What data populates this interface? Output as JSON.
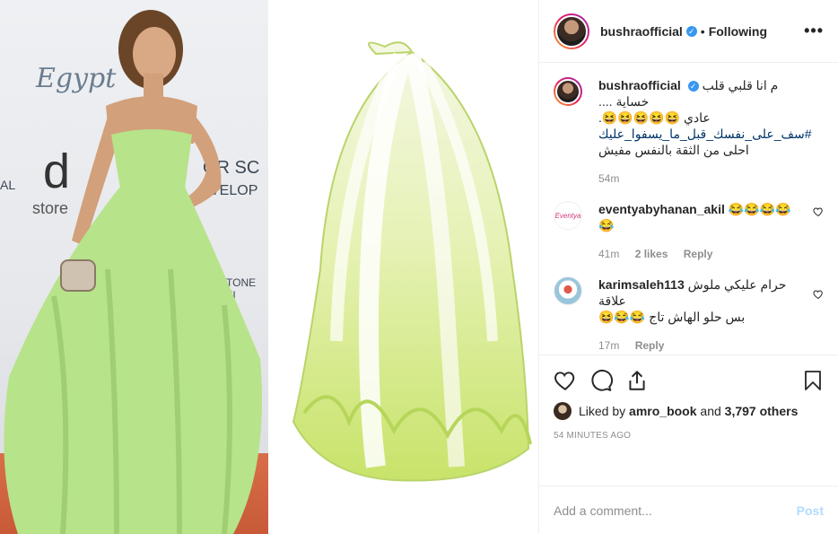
{
  "header": {
    "username": "bushraofficial",
    "verified_mark": "✓",
    "separator": "•",
    "follow_status": "Following",
    "more_label": "•••"
  },
  "media": {
    "left_logos": [
      "Egypt",
      "d",
      "store",
      "OR SC",
      "VELOP",
      "TONE FI",
      "AL"
    ],
    "left_photo": "woman-in-green-gown",
    "right_photo": "napa-cabbage"
  },
  "caption": {
    "username": "bushraofficial",
    "line1": "م انا قلبي قلب خساية ....",
    "line2": "عادي 😆😆😆😆😆.",
    "hashtag": "#سف_على_نفسك_قبل_ما_يسفوا_عليك",
    "line4": "احلى من الثقة بالنفس مفيش",
    "time": "54m"
  },
  "comments": [
    {
      "username": "eventyabyhanan_akil",
      "text": "😂😂😂😂😂",
      "time": "41m",
      "likes": "2 likes",
      "reply": "Reply",
      "avatar_text": "Eventya"
    },
    {
      "username": "karimsaleh113",
      "text": "حرام عليكي ملوش علاقة",
      "text2": "بس حلو الهاش تاج 😂😂😆",
      "time": "17m",
      "reply": "Reply"
    }
  ],
  "footer": {
    "liked_by_prefix": "Liked by",
    "liked_by_user": "amro_book",
    "liked_by_and": "and",
    "others": "3,797 others",
    "timestamp": "54 minutes ago",
    "comment_placeholder": "Add a comment...",
    "post_label": "Post"
  },
  "colors": {
    "link": "#003569",
    "verified": "#3897f0",
    "muted": "#8e8e8e",
    "post_disabled": "#b3dbff",
    "dress_green": "#b7e38a"
  },
  "icons": [
    "heart-icon",
    "comment-icon",
    "share-icon",
    "bookmark-icon",
    "more-icon",
    "verified-badge-icon"
  ]
}
